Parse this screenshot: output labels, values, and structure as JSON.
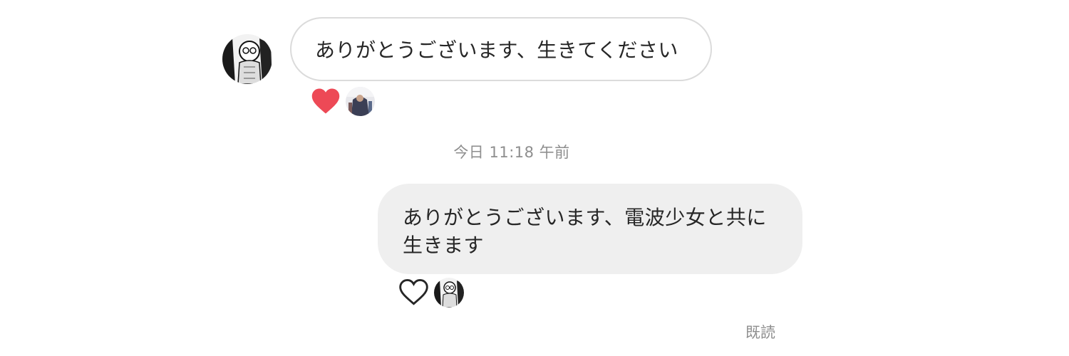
{
  "thread": {
    "incoming_message": {
      "text": "ありがとうございます、生きてください",
      "reaction_icon": "heart-filled-icon",
      "reaction_color": "#ed4956"
    },
    "timestamp": "今日 11:18 午前",
    "outgoing_message": {
      "line1": "ありがとうございます、電波少女と共に",
      "line2": "生きます",
      "reaction_icon": "heart-outline-icon"
    },
    "seen_label": "既読"
  },
  "colors": {
    "incoming_bubble_border": "#dbdbdb",
    "outgoing_bubble_bg": "#efefef",
    "meta_text": "#8e8e8e",
    "body_text": "#262626"
  }
}
